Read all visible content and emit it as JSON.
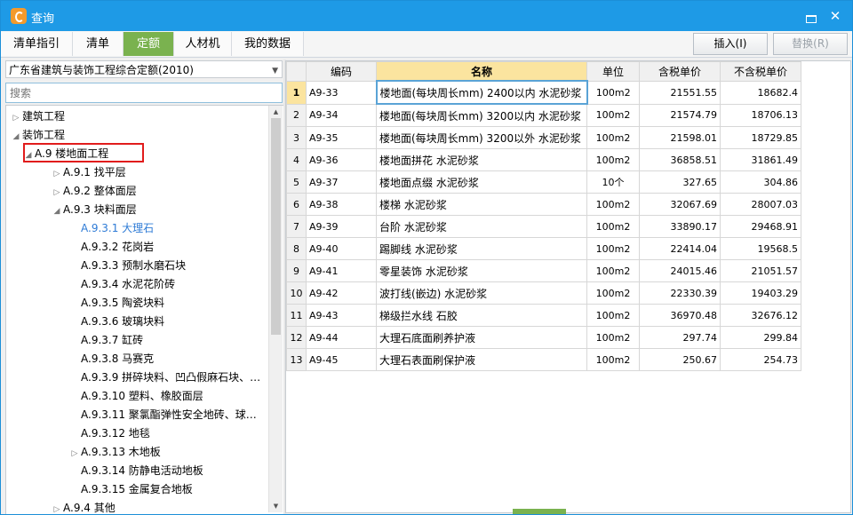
{
  "window": {
    "title": "查询"
  },
  "tabs": [
    {
      "label": "清单指引",
      "active": false
    },
    {
      "label": "清单",
      "active": false
    },
    {
      "label": "定额",
      "active": true
    },
    {
      "label": "人材机",
      "active": false
    },
    {
      "label": "我的数据",
      "active": false
    }
  ],
  "actions": {
    "insert": "插入(I)",
    "replace": "替换(R)"
  },
  "quota_select": {
    "value": "广东省建筑与装饰工程综合定额(2010)"
  },
  "search": {
    "placeholder": "搜索"
  },
  "tree": [
    {
      "text": "建筑工程",
      "toggle": "▷",
      "level": 0
    },
    {
      "text": "装饰工程",
      "toggle": "◢",
      "level": 0
    },
    {
      "text": "A.9 楼地面工程",
      "toggle": "◢",
      "level": 1
    },
    {
      "text": "A.9.1 找平层",
      "toggle": "▷",
      "level": 2
    },
    {
      "text": "A.9.2 整体面层",
      "toggle": "▷",
      "level": 2
    },
    {
      "text": "A.9.3 块料面层",
      "toggle": "◢",
      "level": 2
    },
    {
      "text": "A.9.3.1 大理石",
      "toggle": "",
      "level": 3,
      "selected": true
    },
    {
      "text": "A.9.3.2 花岗岩",
      "toggle": "",
      "level": 3
    },
    {
      "text": "A.9.3.3 预制水磨石块",
      "toggle": "",
      "level": 3
    },
    {
      "text": "A.9.3.4 水泥花阶砖",
      "toggle": "",
      "level": 3
    },
    {
      "text": "A.9.3.5 陶瓷块料",
      "toggle": "",
      "level": 3
    },
    {
      "text": "A.9.3.6 玻璃块料",
      "toggle": "",
      "level": 3
    },
    {
      "text": "A.9.3.7 缸砖",
      "toggle": "",
      "level": 3
    },
    {
      "text": "A.9.3.8 马赛克",
      "toggle": "",
      "level": 3
    },
    {
      "text": "A.9.3.9 拼碎块料、凹凸假麻石块、…",
      "toggle": "",
      "level": 3
    },
    {
      "text": "A.9.3.10 塑料、橡胶面层",
      "toggle": "",
      "level": 3
    },
    {
      "text": "A.9.3.11 聚氯酯弹性安全地砖、球…",
      "toggle": "",
      "level": 3
    },
    {
      "text": "A.9.3.12 地毯",
      "toggle": "",
      "level": 3
    },
    {
      "text": "A.9.3.13 木地板",
      "toggle": "▷",
      "level": 3
    },
    {
      "text": "A.9.3.14 防静电活动地板",
      "toggle": "",
      "level": 3
    },
    {
      "text": "A.9.3.15 金属复合地板",
      "toggle": "",
      "level": 3
    },
    {
      "text": "A.9.4 其他",
      "toggle": "▷",
      "level": 2
    }
  ],
  "table": {
    "headers": [
      "编码",
      "名称",
      "单位",
      "含税单价",
      "不含税单价"
    ],
    "rows": [
      {
        "n": "1",
        "code": "A9-33",
        "name": "楼地面(每块周长mm) 2400以内 水泥砂浆",
        "unit": "100m2",
        "tax": "21551.55",
        "notax": "18682.4"
      },
      {
        "n": "2",
        "code": "A9-34",
        "name": "楼地面(每块周长mm) 3200以内 水泥砂浆",
        "unit": "100m2",
        "tax": "21574.79",
        "notax": "18706.13"
      },
      {
        "n": "3",
        "code": "A9-35",
        "name": "楼地面(每块周长mm) 3200以外 水泥砂浆",
        "unit": "100m2",
        "tax": "21598.01",
        "notax": "18729.85"
      },
      {
        "n": "4",
        "code": "A9-36",
        "name": "楼地面拼花 水泥砂浆",
        "unit": "100m2",
        "tax": "36858.51",
        "notax": "31861.49"
      },
      {
        "n": "5",
        "code": "A9-37",
        "name": "楼地面点缀 水泥砂浆",
        "unit": "10个",
        "tax": "327.65",
        "notax": "304.86"
      },
      {
        "n": "6",
        "code": "A9-38",
        "name": "楼梯 水泥砂浆",
        "unit": "100m2",
        "tax": "32067.69",
        "notax": "28007.03"
      },
      {
        "n": "7",
        "code": "A9-39",
        "name": "台阶 水泥砂浆",
        "unit": "100m2",
        "tax": "33890.17",
        "notax": "29468.91"
      },
      {
        "n": "8",
        "code": "A9-40",
        "name": "踢脚线 水泥砂浆",
        "unit": "100m2",
        "tax": "22414.04",
        "notax": "19568.5"
      },
      {
        "n": "9",
        "code": "A9-41",
        "name": "零星装饰 水泥砂浆",
        "unit": "100m2",
        "tax": "24015.46",
        "notax": "21051.57"
      },
      {
        "n": "10",
        "code": "A9-42",
        "name": "波打线(嵌边) 水泥砂浆",
        "unit": "100m2",
        "tax": "22330.39",
        "notax": "19403.29"
      },
      {
        "n": "11",
        "code": "A9-43",
        "name": "梯级拦水线 石胶",
        "unit": "100m2",
        "tax": "36970.48",
        "notax": "32676.12"
      },
      {
        "n": "12",
        "code": "A9-44",
        "name": "大理石底面刷养护液",
        "unit": "100m2",
        "tax": "297.74",
        "notax": "299.84"
      },
      {
        "n": "13",
        "code": "A9-45",
        "name": "大理石表面刷保护液",
        "unit": "100m2",
        "tax": "250.67",
        "notax": "254.73"
      }
    ]
  }
}
